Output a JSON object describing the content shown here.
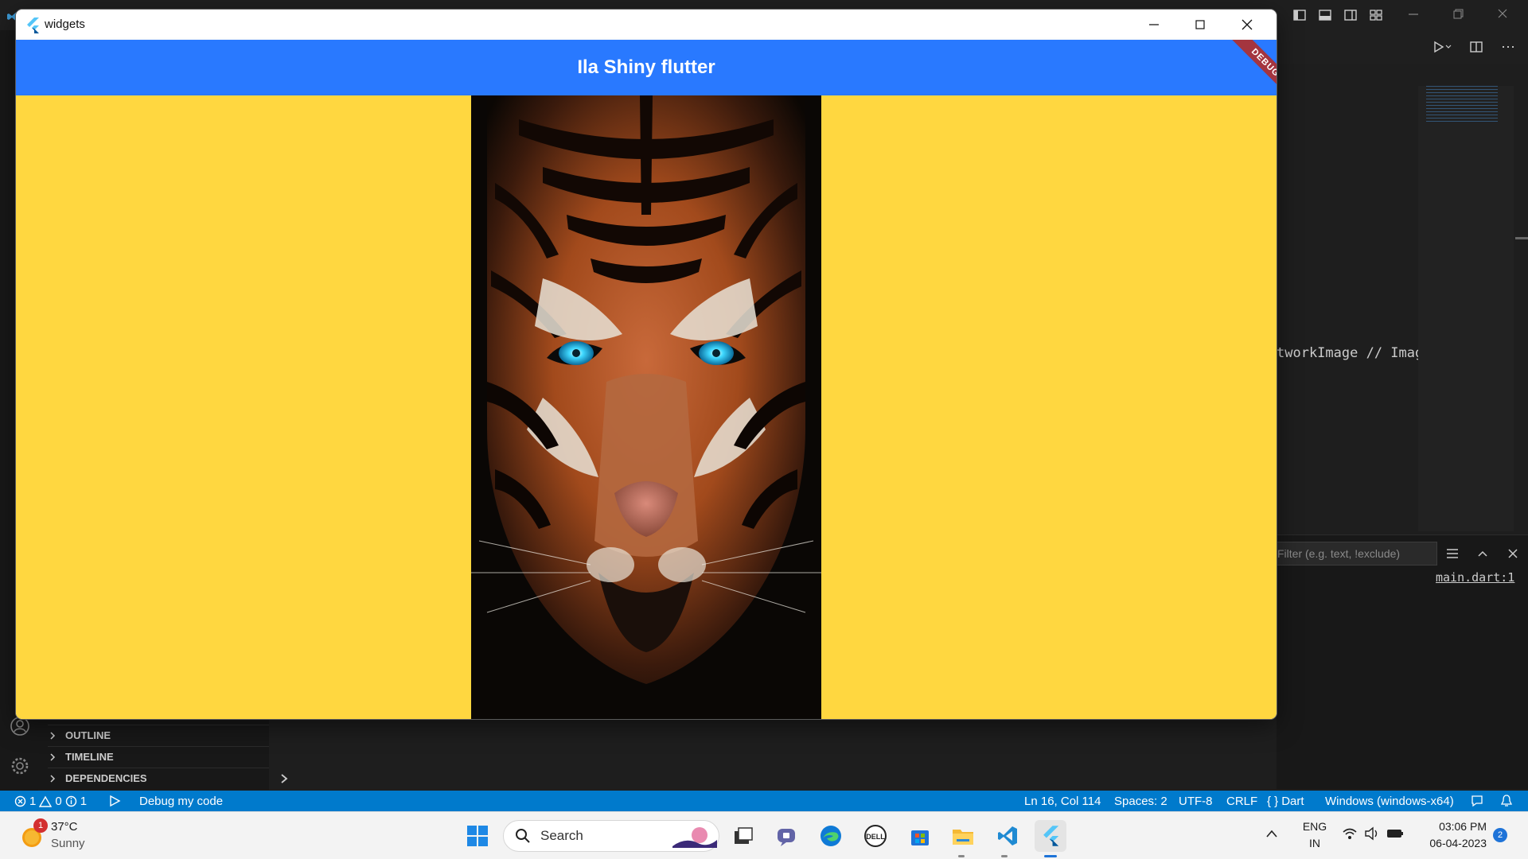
{
  "flutter_window": {
    "title": "widgets",
    "appbar_title": "Ila Shiny flutter",
    "debug_banner": "DEBUG",
    "colors": {
      "appbar": "#2979ff",
      "body": "#ffd740"
    }
  },
  "editor": {
    "code_fragment": "tworkImage // Image",
    "filter_placeholder": "Filter (e.g. text, !exclude)",
    "link": "main.dart:1"
  },
  "sidebar": {
    "sections": [
      {
        "label": "OUTLINE"
      },
      {
        "label": "TIMELINE"
      },
      {
        "label": "DEPENDENCIES"
      }
    ]
  },
  "statusbar": {
    "errors": "1",
    "warnings": "0",
    "infos": "1",
    "debug_label": "Debug my code",
    "position": "Ln 16, Col 114",
    "spaces": "Spaces: 2",
    "encoding": "UTF-8",
    "eol": "CRLF",
    "language": "Dart",
    "platform": "Windows (windows-x64)",
    "color": "#007acc"
  },
  "taskbar": {
    "weather": {
      "temp": "37°C",
      "condition": "Sunny",
      "badge": "1"
    },
    "search_placeholder": "Search",
    "lang": "ENG",
    "region": "IN",
    "time": "03:06 PM",
    "date": "06-04-2023",
    "notification_count": "2"
  }
}
